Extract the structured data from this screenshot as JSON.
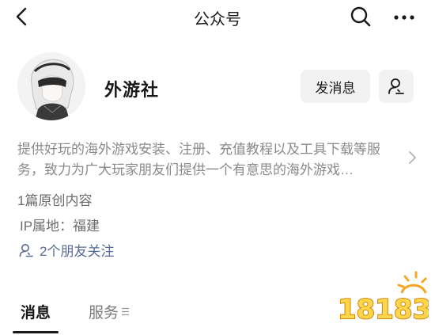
{
  "nav": {
    "title": "公众号"
  },
  "profile": {
    "name": "外游社",
    "message_button": "发消息",
    "description": "提供好玩的海外游戏安装、注册、充值教程以及工具下载等服务，致力为广大玩家朋友们提供一个有意思的海外游戏…",
    "original_count": "1篇原创内容",
    "ip_location": "IP属地：福建",
    "friends_follow": "2个朋友关注"
  },
  "tabs": [
    {
      "label": "消息",
      "active": true
    },
    {
      "label": "服务",
      "active": false
    }
  ],
  "watermark": {
    "text": "18183"
  },
  "colors": {
    "text": "#191919",
    "secondary": "#8a8a8a",
    "link": "#576b95",
    "button_bg": "#f2f2f2",
    "watermark": "#f5a623"
  },
  "icons": [
    "back-arrow-icon",
    "search-icon",
    "more-icon",
    "user-check-icon",
    "chevron-right-icon",
    "friends-icon",
    "menu-lines-icon"
  ]
}
